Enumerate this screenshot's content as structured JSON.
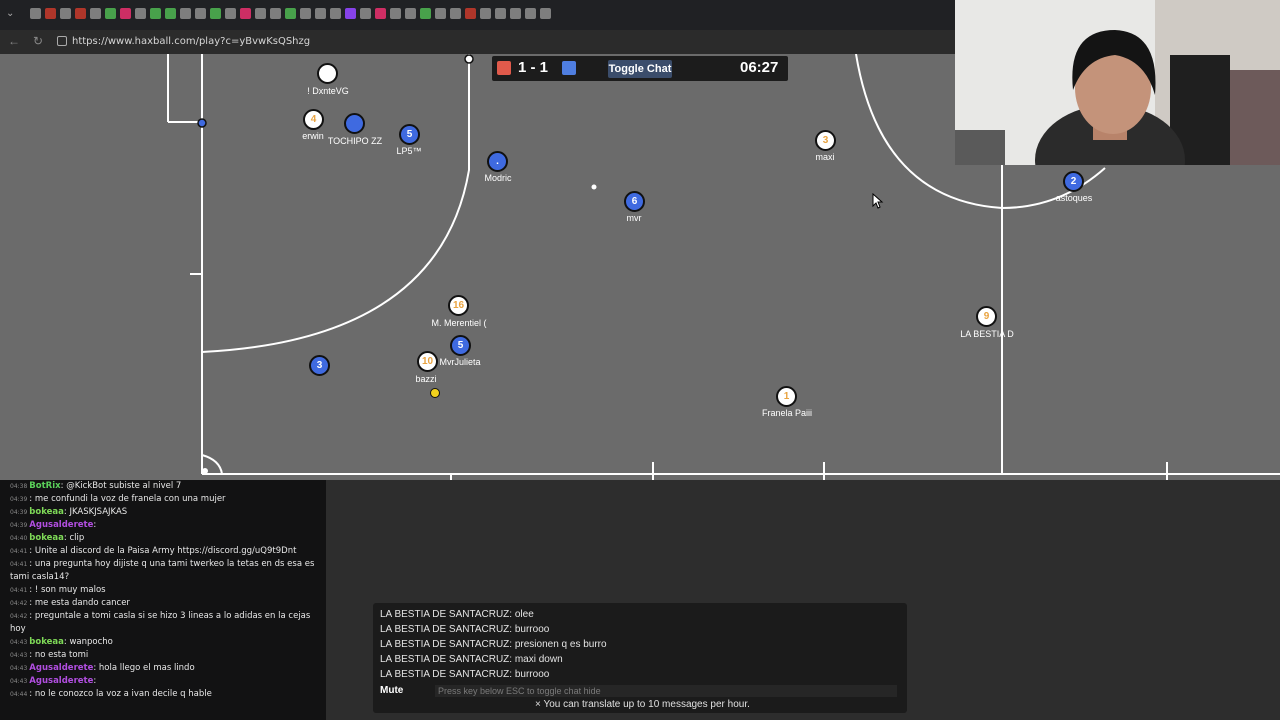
{
  "browser": {
    "url": "https://www.haxball.com/play?c=yBvwKsQShzg"
  },
  "scoreboard": {
    "score": "1 - 1",
    "toggle_chat": "Toggle Chat",
    "time": "06:27",
    "red_color": "#e05a4b",
    "blue_color": "#4f7ee0"
  },
  "players": [
    {
      "number": "",
      "name": "! DxnteVG",
      "team": "red"
    },
    {
      "number": "4",
      "name": "erwin",
      "team": "red"
    },
    {
      "number": "",
      "name": "TOCHIPO ZZ",
      "team": "blue"
    },
    {
      "number": "5",
      "name": "LP5™",
      "team": "blue"
    },
    {
      "number": ".",
      "name": "Modric",
      "team": "blue"
    },
    {
      "number": "6",
      "name": "mvr",
      "team": "blue"
    },
    {
      "number": "3",
      "name": "maxi",
      "team": "red"
    },
    {
      "number": "2",
      "name": "astoques",
      "team": "blue"
    },
    {
      "number": "16",
      "name": "M. Merentiel (",
      "team": "red"
    },
    {
      "number": "5",
      "name": "MvrJulieta",
      "team": "blue"
    },
    {
      "number": "10",
      "name": "bazzi",
      "team": "red"
    },
    {
      "number": "3",
      "name": "",
      "team": "blue"
    },
    {
      "number": "9",
      "name": "LA BESTIA D",
      "team": "red"
    },
    {
      "number": "1",
      "name": "Franela Paiii",
      "team": "red"
    }
  ],
  "twitch_chat": [
    {
      "time": "04:38",
      "user": "BotRix",
      "color": "#5ad15a",
      "text": ": @KickBot subiste al nivel 7"
    },
    {
      "time": "04:39",
      "user": "",
      "color": "#c0392b",
      "text": ": me confundi la voz de franela con una mujer"
    },
    {
      "time": "04:39",
      "user": "bokeaa",
      "color": "#7ed957",
      "text": ": JKASKJSAJKAS"
    },
    {
      "time": "04:39",
      "user": "Agusalderete",
      "color": "#b14ee0",
      "text": ": "
    },
    {
      "time": "04:40",
      "user": "bokeaa",
      "color": "#7ed957",
      "text": ": clip"
    },
    {
      "time": "04:41",
      "user": "",
      "color": "#c0392b",
      "text": ": Unite al discord de la Paisa Army https://discord.gg/uQ9t9Dnt"
    },
    {
      "time": "04:41",
      "user": "",
      "color": "#c0392b",
      "text": ": una pregunta hoy dijiste q una tami twerkeo la tetas en ds esa es tami casla14?"
    },
    {
      "time": "04:41",
      "user": "",
      "color": "#c0392b",
      "text": ": ! son muy malos"
    },
    {
      "time": "04:42",
      "user": "",
      "color": "#c0392b",
      "text": ": me esta dando cancer"
    },
    {
      "time": "04:42",
      "user": "",
      "color": "#c0392b",
      "text": ": preguntale a tomi casla si se hizo 3 lineas a lo adidas en la cejas hoy"
    },
    {
      "time": "04:43",
      "user": "bokeaa",
      "color": "#7ed957",
      "text": ": wanpocho"
    },
    {
      "time": "04:43",
      "user": "",
      "color": "#c0392b",
      "text": ": no esta tomi"
    },
    {
      "time": "04:43",
      "user": "Agusalderete",
      "color": "#b14ee0",
      "text": ": hola llego el mas lindo"
    },
    {
      "time": "04:43",
      "user": "Agusalderete",
      "color": "#b14ee0",
      "text": ": "
    },
    {
      "time": "04:44",
      "user": "",
      "color": "#c0392b",
      "text": ": no le conozco la voz a ivan decile q hable"
    }
  ],
  "game_chat": {
    "lines": [
      "LA BESTIA DE SANTACRUZ: olee",
      "LA BESTIA DE SANTACRUZ: burrooo",
      "LA BESTIA DE SANTACRUZ: presionen q es burro",
      "LA BESTIA DE SANTACRUZ: maxi down",
      "LA BESTIA DE SANTACRUZ: burrooo"
    ],
    "mute": "Mute",
    "input_placeholder": "Press key below ESC to toggle chat hide",
    "translate_note": "× You can translate up to 10 messages per hour."
  }
}
